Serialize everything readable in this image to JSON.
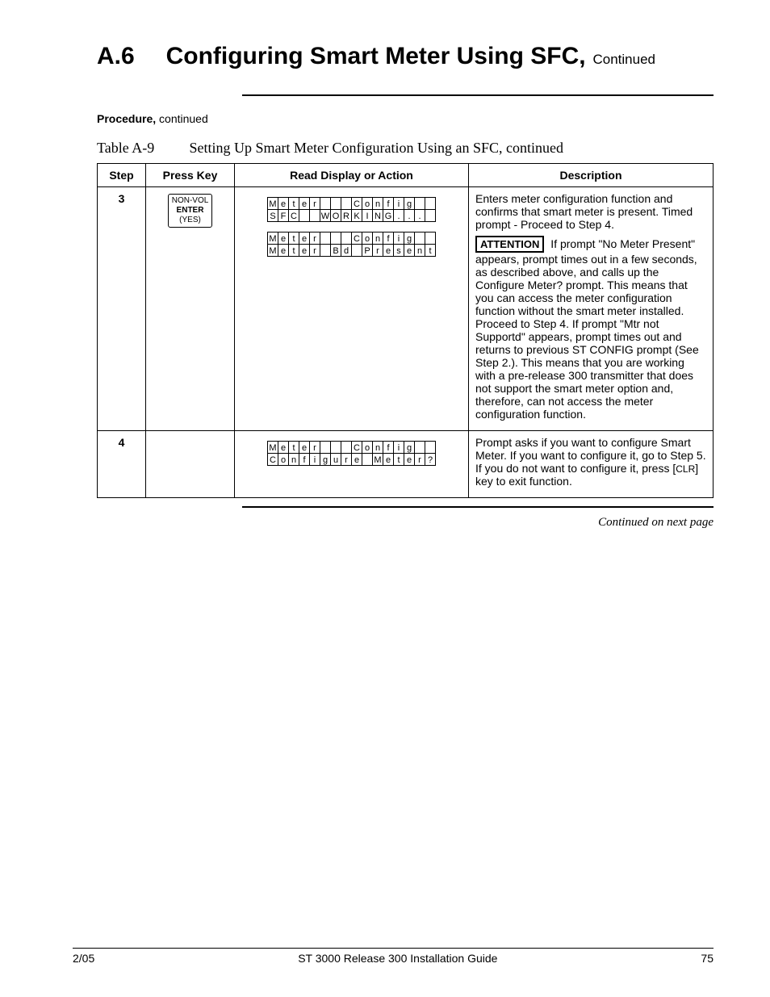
{
  "heading": {
    "number": "A.6",
    "title": "Configuring Smart Meter Using SFC,",
    "continued": "Continued"
  },
  "procedure_label": "Procedure,",
  "procedure_cont": " continued",
  "table_caption": {
    "label": "Table A-9",
    "text": "Setting Up Smart Meter Configuration Using an SFC, continued"
  },
  "columns": {
    "step": "Step",
    "press_key": "Press Key",
    "read_display": "Read Display or Action",
    "description": "Description"
  },
  "rows": [
    {
      "step": "3",
      "key": {
        "line1": "NON-VOL",
        "line2": "ENTER",
        "line3": "(YES)"
      },
      "displays": [
        {
          "line1": "Meter   Config  ",
          "line2": "SFC  WORKING... "
        },
        {
          "line1": "Meter   Config  ",
          "line2": "Meter Bd Present"
        }
      ],
      "description": {
        "p1": "Enters meter configuration function and confirms that smart meter is present. Timed prompt - Proceed to Step 4.",
        "attention_label": "ATTENTION",
        "p2a": " If prompt \"No Meter Present\" appears, prompt times out in a few seconds, as described above, and calls up the Configure Meter?  prompt. This means that you can access the meter configuration function without the smart meter installed. Proceed to Step 4.  If prompt \"Mtr not Supportd\" appears, prompt times out and returns to previous ST CONFIG prompt (See Step 2.). This means that you are working with a pre-release 300 transmitter that does not support the smart meter option and, therefore, can not access the meter configuration function."
      }
    },
    {
      "step": "4",
      "key": null,
      "displays": [
        {
          "line1": "Meter   Config  ",
          "line2": "Configure Meter?"
        }
      ],
      "description": {
        "p1a": "Prompt asks if you want to configure Smart Meter. If you want to configure it, go to Step 5. If you do not want to configure it, press [",
        "clr": "CLR",
        "p1b": "] key to exit function."
      }
    }
  ],
  "continued_next": "Continued on next page",
  "footer": {
    "left": "2/05",
    "center": "ST 3000 Release 300 Installation Guide",
    "right": "75"
  }
}
